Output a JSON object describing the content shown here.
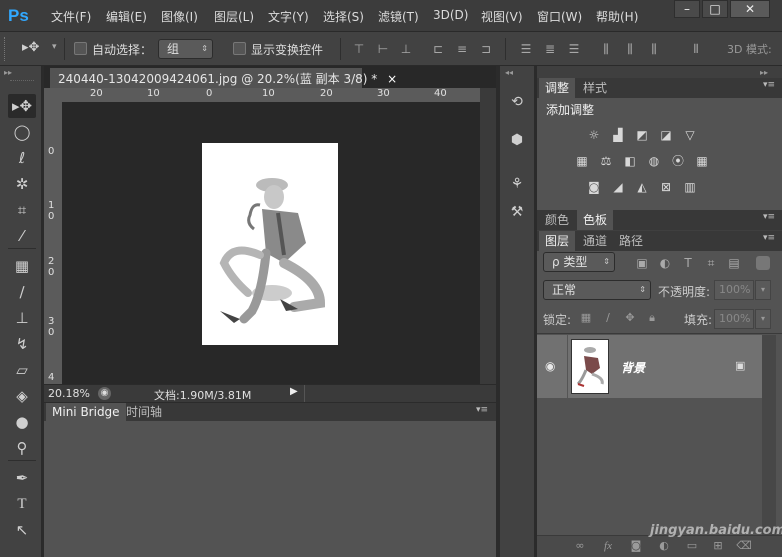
{
  "app": {
    "logo": "Ps"
  },
  "menu": [
    "文件(F)",
    "编辑(E)",
    "图像(I)",
    "图层(L)",
    "文字(Y)",
    "选择(S)",
    "滤镜(T)",
    "3D(D)",
    "视图(V)",
    "窗口(W)",
    "帮助(H)"
  ],
  "window_controls": [
    "–",
    "□",
    "✕"
  ],
  "options": {
    "auto_select_label": "自动选择：",
    "auto_select_value": "组",
    "show_transform_label": "显示变换控件",
    "mode_3d_label": "3D 模式:"
  },
  "document": {
    "tab_title": "240440-13042009424061.jpg @ 20.2%(蓝 副本 3/8) *",
    "tab_close": "×",
    "ruler_h": [
      "20",
      "10",
      "0",
      "10",
      "20",
      "30",
      "40"
    ],
    "ruler_v": [
      "0",
      "1 0",
      "2 0",
      "3 0",
      "4"
    ],
    "zoom": "20.18%",
    "doc_info": "文档:1.90M/3.81M"
  },
  "bottom_panel": {
    "tabs": [
      "Mini Bridge",
      "时间轴"
    ]
  },
  "adjustments": {
    "tabs": [
      "调整",
      "样式"
    ],
    "title": "添加调整",
    "row1": [
      "brightness-icon",
      "levels-icon",
      "curves-icon",
      "exposure-icon",
      "triangle-icon"
    ],
    "row2": [
      "vibrance-icon",
      "balance-icon",
      "bw-icon",
      "photo-filter-icon",
      "channel-mixer-icon",
      "lookup-icon"
    ],
    "row3": [
      "invert-icon",
      "posterize-icon",
      "threshold-icon",
      "selective-color-icon",
      "gradient-map-icon"
    ]
  },
  "color_panel": {
    "tabs": [
      "颜色",
      "色板"
    ]
  },
  "layers_panel": {
    "tabs": [
      "图层",
      "通道",
      "路径"
    ],
    "filter_label": "ρ 类型",
    "blend_mode": "正常",
    "opacity_label": "不透明度:",
    "opacity_value": "100%",
    "lock_label": "锁定:",
    "fill_label": "填充:",
    "fill_value": "100%",
    "layer_name": "背景"
  },
  "watermark": "jingyan.baidu.com"
}
